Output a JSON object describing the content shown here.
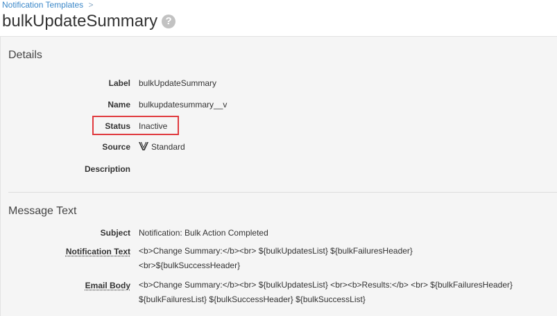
{
  "breadcrumb": {
    "link": "Notification Templates",
    "separator": ">"
  },
  "page": {
    "title": "bulkUpdateSummary",
    "help_icon": "help-icon"
  },
  "details": {
    "title": "Details",
    "fields": {
      "label": {
        "label": "Label",
        "value": "bulkUpdateSummary"
      },
      "name": {
        "label": "Name",
        "value": "bulkupdatesummary__v"
      },
      "status": {
        "label": "Status",
        "value": "Inactive"
      },
      "source": {
        "label": "Source",
        "value": "Standard",
        "icon": "veeva-v-icon"
      },
      "description": {
        "label": "Description",
        "value": ""
      }
    }
  },
  "message": {
    "title": "Message Text",
    "fields": {
      "subject": {
        "label": "Subject",
        "value": "Notification: Bulk Action Completed"
      },
      "notification_text": {
        "label": "Notification Text",
        "value": "<b>Change Summary:</b><br> ${bulkUpdatesList} ${bulkFailuresHeader} <br>${bulkSuccessHeader}"
      },
      "email_body": {
        "label": "Email Body",
        "value": "<b>Change Summary:</b><br> ${bulkUpdatesList} <br><b>Results:</b> <br> ${bulkFailuresHeader} ${bulkFailuresList} ${bulkSuccessHeader} ${bulkSuccessList}"
      }
    }
  },
  "colors": {
    "link": "#3a87c8",
    "highlight": "#e0393e",
    "panel_bg": "#f5f5f5"
  }
}
